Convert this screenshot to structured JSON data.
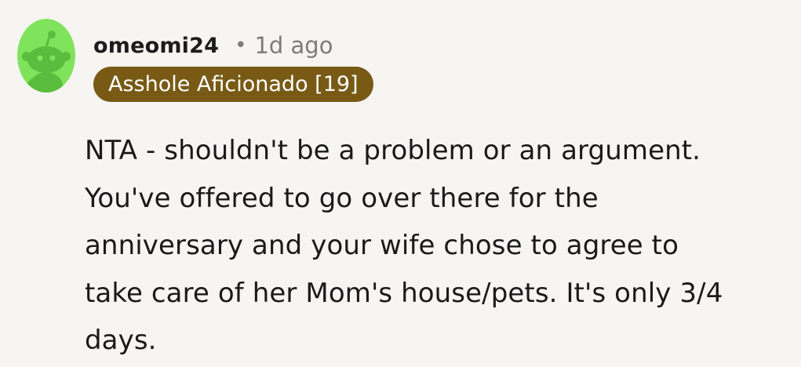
{
  "comment": {
    "author": "omeomi24",
    "separator": "•",
    "time_ago": "1d ago",
    "flair": "Asshole Aficionado [19]",
    "lines": [
      "NTA - shouldn't be a problem or an argument.",
      "You've offered to go over there for the",
      "anniversary and your wife chose to agree to",
      "take care of her Mom's house/pets. It's only 3/4",
      "days."
    ]
  },
  "colors": {
    "background": "#f7f5f2",
    "avatar_bg": "#7fe35c",
    "snoo_color": "#5bbd3e",
    "flair_bg": "#785a15",
    "flair_text": "#ffffff",
    "meta_text": "#7c7c7c"
  },
  "icons": {
    "avatar": "snoo-avatar-icon"
  }
}
